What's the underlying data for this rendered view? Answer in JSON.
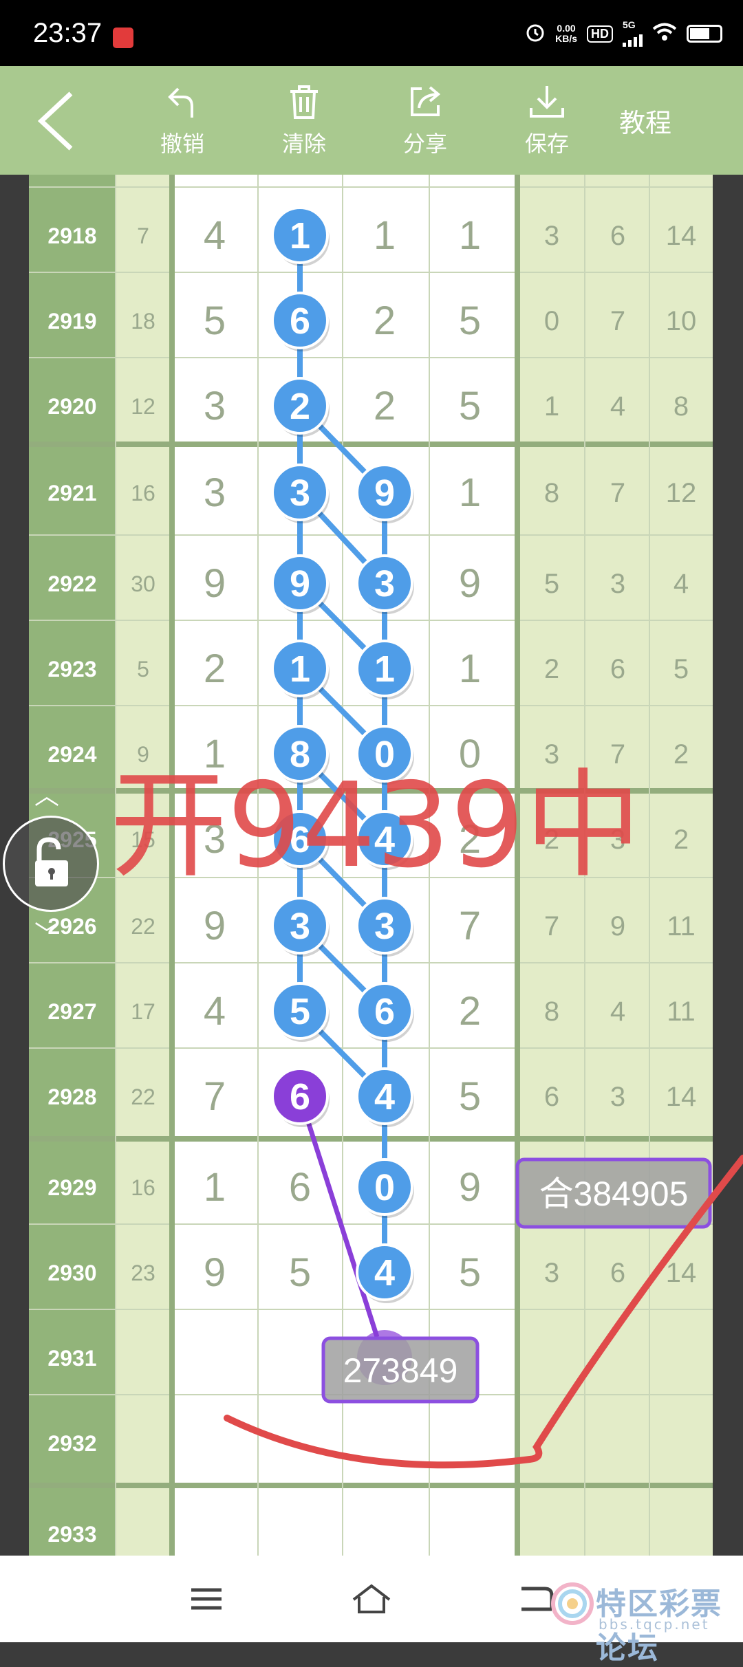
{
  "status_bar": {
    "time": "23:37",
    "net_speed_value": "0.00",
    "net_speed_unit": "KB/s",
    "hd_label": "HD",
    "network_label": "5G"
  },
  "toolbar": {
    "undo_label": "撤销",
    "clear_label": "清除",
    "share_label": "分享",
    "save_label": "保存",
    "tutorial_label": "教程"
  },
  "table": {
    "rows": [
      {
        "issue": "2918",
        "sum": "7",
        "d": [
          "4",
          "1",
          "1",
          "1"
        ],
        "r": [
          "3",
          "6",
          "14"
        ]
      },
      {
        "issue": "2919",
        "sum": "18",
        "d": [
          "5",
          "6",
          "2",
          "5"
        ],
        "r": [
          "0",
          "7",
          "10"
        ]
      },
      {
        "issue": "2920",
        "sum": "12",
        "d": [
          "3",
          "2",
          "2",
          "5"
        ],
        "r": [
          "1",
          "4",
          "8"
        ]
      },
      {
        "issue": "2921",
        "sum": "16",
        "d": [
          "3",
          "3",
          "9",
          "1"
        ],
        "r": [
          "8",
          "7",
          "12"
        ]
      },
      {
        "issue": "2922",
        "sum": "30",
        "d": [
          "9",
          "9",
          "3",
          "9"
        ],
        "r": [
          "5",
          "3",
          "4"
        ]
      },
      {
        "issue": "2923",
        "sum": "5",
        "d": [
          "2",
          "1",
          "1",
          "1"
        ],
        "r": [
          "2",
          "6",
          "5"
        ]
      },
      {
        "issue": "2924",
        "sum": "9",
        "d": [
          "1",
          "8",
          "0",
          "0"
        ],
        "r": [
          "3",
          "7",
          "2"
        ]
      },
      {
        "issue": "2925",
        "sum": "15",
        "d": [
          "3",
          "6",
          "4",
          "2"
        ],
        "r": [
          "2",
          "3",
          "2"
        ]
      },
      {
        "issue": "2926",
        "sum": "22",
        "d": [
          "9",
          "3",
          "3",
          "7"
        ],
        "r": [
          "7",
          "9",
          "11"
        ]
      },
      {
        "issue": "2927",
        "sum": "17",
        "d": [
          "4",
          "5",
          "6",
          "2"
        ],
        "r": [
          "8",
          "4",
          "11"
        ]
      },
      {
        "issue": "2928",
        "sum": "22",
        "d": [
          "7",
          "6",
          "4",
          "5"
        ],
        "r": [
          "6",
          "3",
          "14"
        ]
      },
      {
        "issue": "2929",
        "sum": "16",
        "d": [
          "1",
          "6",
          "0",
          "9"
        ],
        "r": [
          "",
          "",
          ""
        ]
      },
      {
        "issue": "2930",
        "sum": "23",
        "d": [
          "9",
          "5",
          "4",
          "5"
        ],
        "r": [
          "3",
          "6",
          "14"
        ]
      },
      {
        "issue": "2931",
        "sum": "",
        "d": [
          "",
          "",
          "",
          ""
        ],
        "r": [
          "",
          "",
          ""
        ]
      },
      {
        "issue": "2932",
        "sum": "",
        "d": [
          "",
          "",
          "",
          ""
        ],
        "r": [
          "",
          "",
          ""
        ]
      },
      {
        "issue": "2933",
        "sum": "",
        "d": [
          "",
          "",
          "",
          ""
        ],
        "r": [
          "",
          "",
          ""
        ]
      }
    ],
    "blue_circles": [
      {
        "row": 0,
        "col": 1
      },
      {
        "row": 1,
        "col": 1
      },
      {
        "row": 2,
        "col": 1
      },
      {
        "row": 3,
        "col": 1
      },
      {
        "row": 3,
        "col": 2
      },
      {
        "row": 4,
        "col": 1
      },
      {
        "row": 4,
        "col": 2
      },
      {
        "row": 5,
        "col": 1
      },
      {
        "row": 5,
        "col": 2
      },
      {
        "row": 6,
        "col": 1
      },
      {
        "row": 6,
        "col": 2
      },
      {
        "row": 7,
        "col": 1
      },
      {
        "row": 7,
        "col": 2
      },
      {
        "row": 8,
        "col": 1
      },
      {
        "row": 8,
        "col": 2
      },
      {
        "row": 9,
        "col": 1
      },
      {
        "row": 9,
        "col": 2
      },
      {
        "row": 10,
        "col": 2
      },
      {
        "row": 11,
        "col": 2
      },
      {
        "row": 12,
        "col": 2
      }
    ],
    "purple_circles": [
      {
        "row": 10,
        "col": 1
      }
    ]
  },
  "annotations": {
    "handwritten": "开9439中",
    "right_box": "合384905",
    "bottom_box": "273849"
  },
  "colors": {
    "toolbar_bg": "#a9c98f",
    "left_col_bg": "#92b47a",
    "light_col_bg": "#e3ecc8",
    "blue_ball": "#4f9de8",
    "purple_ball": "#8a3fd8",
    "red_ink": "#e04a4a"
  },
  "watermark": {
    "text": "特区彩票论坛",
    "url": "bbs.tqcp.net"
  }
}
